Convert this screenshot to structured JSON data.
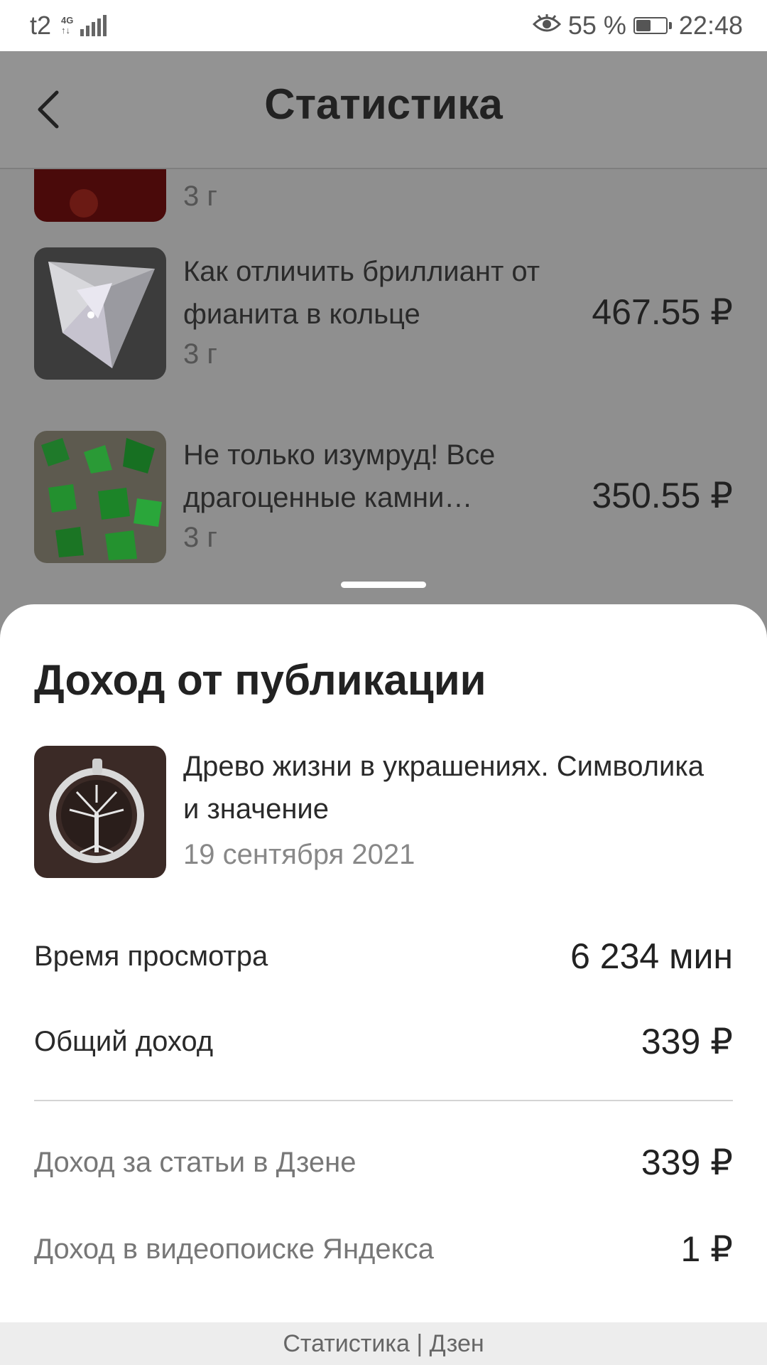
{
  "status_bar": {
    "carrier": "t2",
    "network_top": "4G",
    "network_bottom": "↑↓",
    "battery_percent": "55 %",
    "time": "22:48"
  },
  "header": {
    "title": "Статистика"
  },
  "list": {
    "partial_item_meta": "3 г",
    "items": [
      {
        "title": "Как отличить бриллиант от фианита в кольце",
        "meta": "3 г",
        "amount": "467.55 ₽"
      },
      {
        "title": "Не только изумруд! Все драгоценные камни…",
        "meta": "3 г",
        "amount": "350.55 ₽"
      }
    ]
  },
  "sheet": {
    "title": "Доход от публикации",
    "publication": {
      "title": "Древо жизни в украшениях. Символика и значение",
      "date": "19 сентября 2021"
    },
    "rows": [
      {
        "label": "Время просмотра",
        "value": "6 234 мин"
      },
      {
        "label": "Общий доход",
        "value": "339 ₽"
      },
      {
        "label": "Доход за статьи в Дзене",
        "value": "339 ₽"
      },
      {
        "label": "Доход в видеопоиске Яндекса",
        "value": "1 ₽"
      }
    ]
  },
  "footer": {
    "text": "Статистика | Дзен"
  }
}
